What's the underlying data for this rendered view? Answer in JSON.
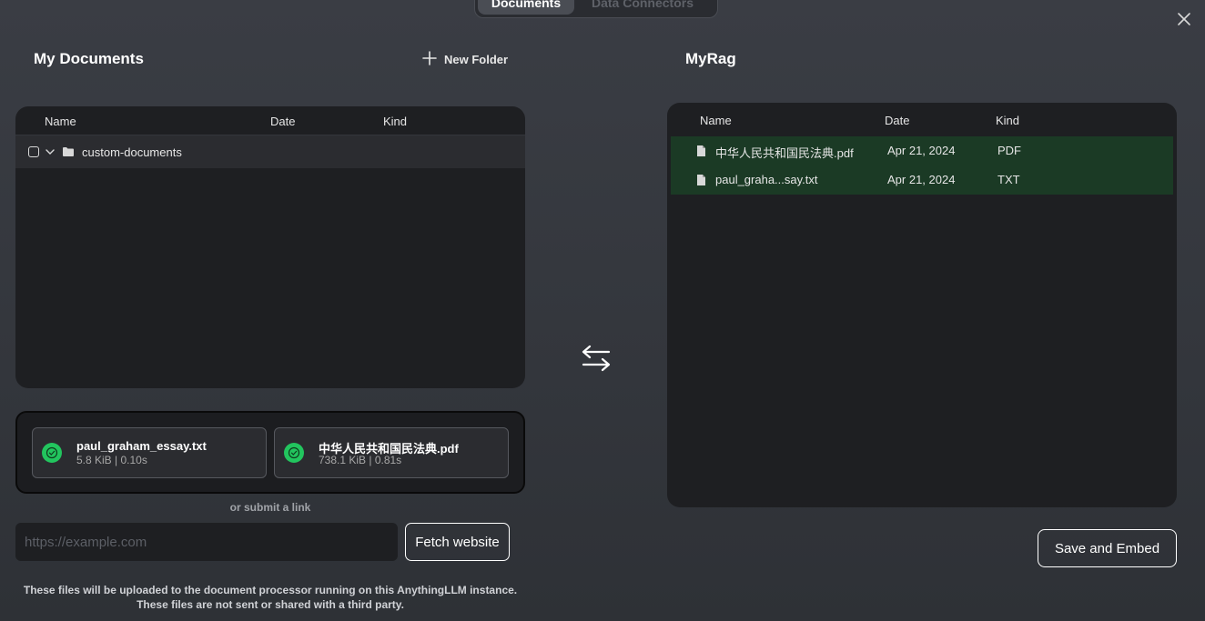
{
  "tabs": [
    {
      "label": "Documents",
      "active": true
    },
    {
      "label": "Data Connectors",
      "active": false
    }
  ],
  "left_panel": {
    "title": "My Documents",
    "new_folder_label": "New Folder",
    "columns": [
      "Name",
      "Date",
      "Kind"
    ],
    "folder": {
      "name": "custom-documents",
      "expanded": false,
      "checked": false
    }
  },
  "right_panel": {
    "title": "MyRag",
    "columns": [
      "Name",
      "Date",
      "Kind"
    ],
    "files": [
      {
        "name": "中华人民共和国民法典.pdf",
        "date": "Apr 21, 2024",
        "kind": "PDF"
      },
      {
        "name": "paul_graha...say.txt",
        "date": "Apr 21, 2024",
        "kind": "TXT"
      }
    ]
  },
  "uploads": [
    {
      "name": "paul_graham_essay.txt",
      "meta": "5.8 KiB | 0.10s",
      "status": "success"
    },
    {
      "name": "中华人民共和国民法典.pdf",
      "meta": "738.1 KiB | 0.81s",
      "status": "success"
    }
  ],
  "link": {
    "or_label": "or submit a link",
    "placeholder": "https://example.com",
    "value": "",
    "fetch_label": "Fetch website"
  },
  "notice": {
    "line1": "These files will be uploaded to the document processor running on this AnythingLLM instance.",
    "line2": "These files are not sent or shared with a third party."
  },
  "save_label": "Save and Embed",
  "colors": {
    "success": "#22c55e",
    "selected_row": "#1b3a25",
    "panel_bg": "#1e1f22"
  },
  "icons": {
    "close": "close-icon",
    "plus": "plus-icon",
    "folder": "folder-icon",
    "chevron": "chevron-down-icon",
    "file": "file-icon",
    "swap": "swap-arrows-icon",
    "check": "check-circle-icon"
  }
}
